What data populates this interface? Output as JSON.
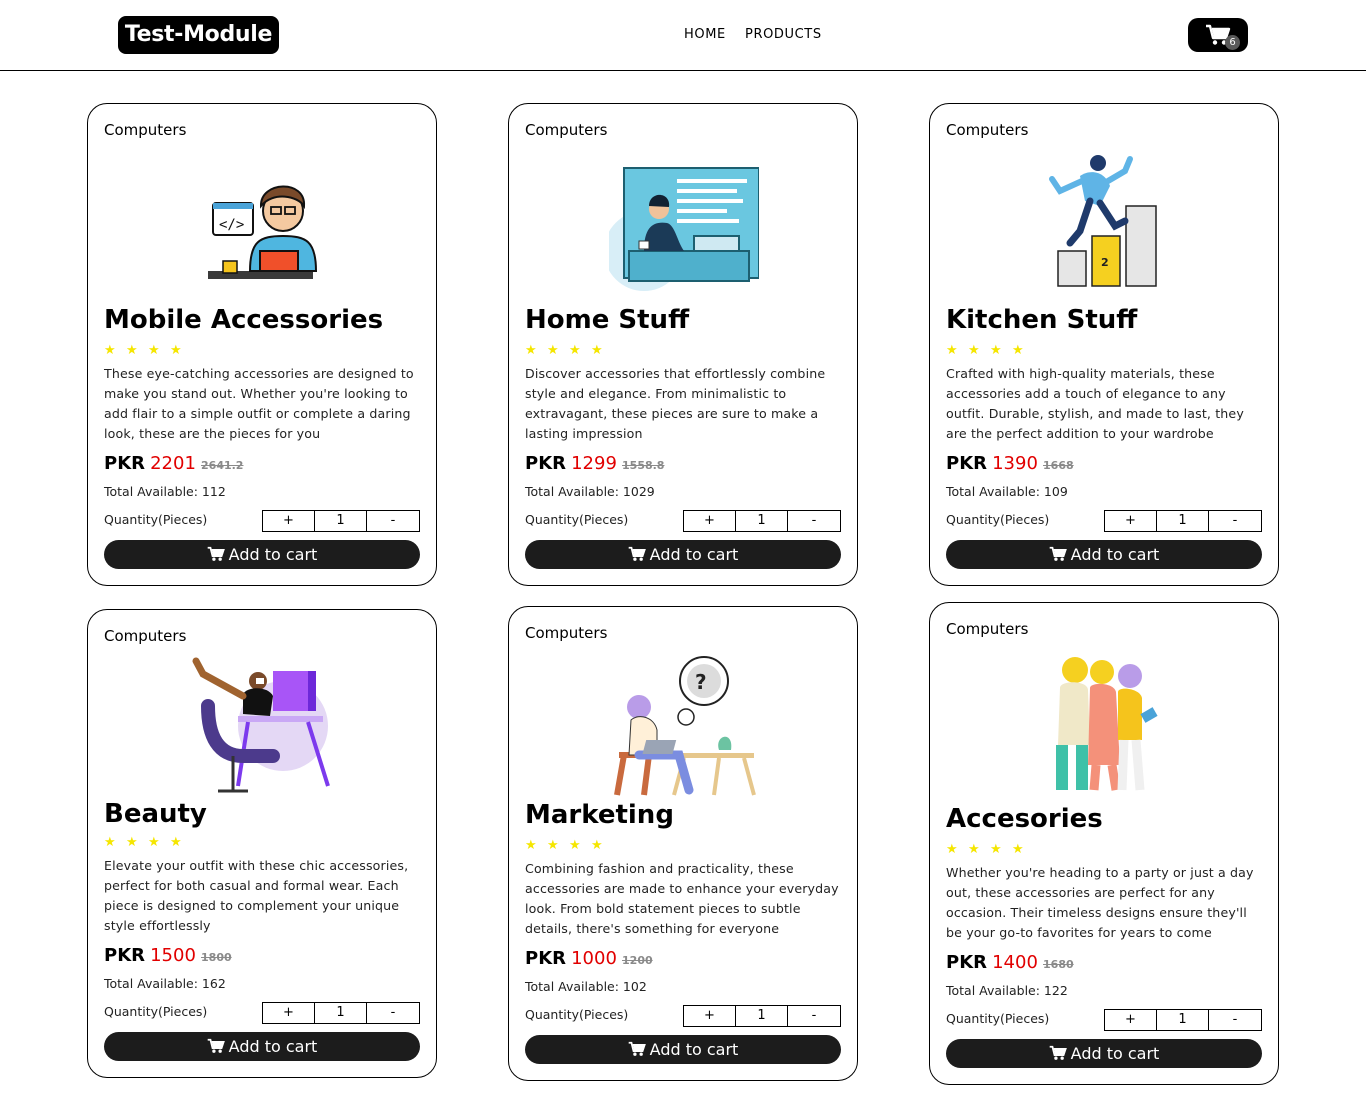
{
  "header": {
    "logo": "Test-Module",
    "nav": [
      "HOME",
      "PRODUCTS"
    ],
    "cart_count": "6"
  },
  "labels": {
    "currency": "PKR",
    "total_available_prefix": "Total Available:",
    "quantity_label": "Quantity(Pieces)",
    "plus": "+",
    "minus": "-",
    "add_to_cart": "Add to cart"
  },
  "colors": {
    "price": "#e10000",
    "star": "#f5e600",
    "button": "#1c1c1c"
  },
  "products": [
    {
      "category": "Computers",
      "title": "Mobile Accessories",
      "rating": 4,
      "description": "These eye-catching accessories are designed to make you stand out. Whether you're looking to add flair to a simple outfit or complete a daring look, these are the pieces for you",
      "price": "2201",
      "old_price": "2641.2",
      "total_available": "Total Available: 112",
      "quantity": "1",
      "image_icon": "developer-illustration"
    },
    {
      "category": "Computers",
      "title": "Home Stuff",
      "rating": 4,
      "description": "Discover accessories that effortlessly combine style and elegance. From minimalistic to extravagant, these pieces are sure to make a lasting impression",
      "price": "1299",
      "old_price": "1558.8",
      "total_available": "Total Available: 1029",
      "quantity": "1",
      "image_icon": "presentation-illustration"
    },
    {
      "category": "Computers",
      "title": "Kitchen Stuff",
      "rating": 4,
      "description": "Crafted with high-quality materials, these accessories add a touch of elegance to any outfit. Durable, stylish, and made to last, they are the perfect addition to your wardrobe",
      "price": "1390",
      "old_price": "1668",
      "total_available": "Total Available: 109",
      "quantity": "1",
      "image_icon": "podium-runner-illustration"
    },
    {
      "category": "Computers",
      "title": "Beauty",
      "rating": 4,
      "description": "Elevate your outfit with these chic accessories, perfect for both casual and formal wear. Each piece is designed to complement your unique style effortlessly",
      "price": "1500",
      "old_price": "1800",
      "total_available": "Total Available: 162",
      "quantity": "1",
      "image_icon": "desk-worker-illustration"
    },
    {
      "category": "Computers",
      "title": "Marketing",
      "rating": 4,
      "description": "Combining fashion and practicality, these accessories are made to enhance your everyday look. From bold statement pieces to subtle details, there's something for everyone",
      "price": "1000",
      "old_price": "1200",
      "total_available": "Total Available: 102",
      "quantity": "1",
      "image_icon": "laptop-thinker-illustration"
    },
    {
      "category": "Computers",
      "title": "Accesories",
      "rating": 4,
      "description": "Whether you're heading to a party or just a day out, these accessories are perfect for any occasion. Their timeless designs ensure they'll be your go-to favorites for years to come",
      "price": "1400",
      "old_price": "1680",
      "total_available": "Total Available: 122",
      "quantity": "1",
      "image_icon": "friends-group-illustration"
    }
  ]
}
